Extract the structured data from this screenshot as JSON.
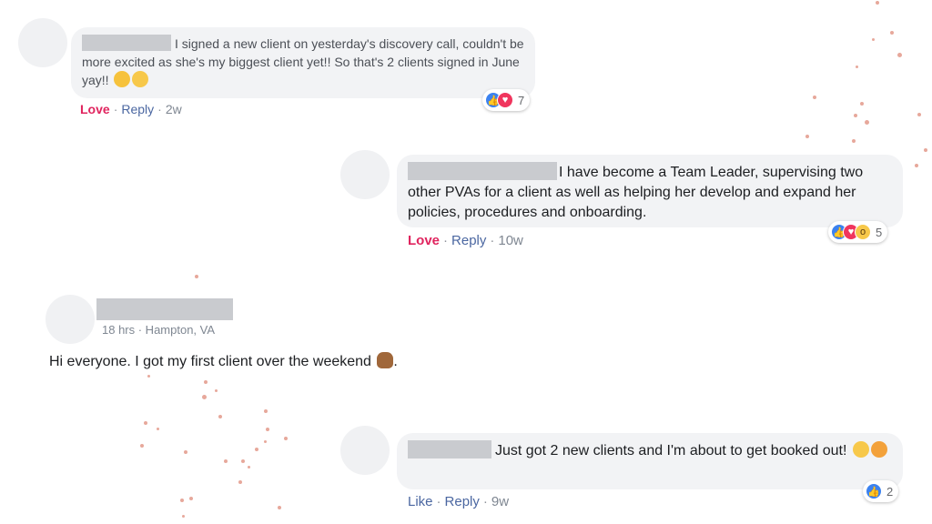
{
  "comments": [
    {
      "text": "I signed a new client on yesterday's discovery call, couldn't be more excited as she's my biggest client yet!! So that's 2 clients signed in June yay!!",
      "emoji": [
        "party-face-emoji",
        "grinning-face-emoji"
      ],
      "reactions": {
        "icons": [
          "like",
          "love"
        ],
        "count": "7"
      },
      "action_primary": "Love",
      "reply": "Reply",
      "time": "2w"
    },
    {
      "text": "I have become a Team Leader, supervising two other PVAs for a client as well as helping her develop and expand her policies, procedures and onboarding.",
      "reactions": {
        "icons": [
          "like",
          "love",
          "wow"
        ],
        "count": "5"
      },
      "action_primary": "Love",
      "reply": "Reply",
      "time": "10w"
    },
    {
      "text": "Just got 2 new clients and I'm about to get booked out!",
      "emoji": [
        "grinning-face-emoji",
        "smiling-hearts-emoji"
      ],
      "reactions": {
        "icons": [
          "like"
        ],
        "count": "2"
      },
      "action_primary": "Like",
      "reply": "Reply",
      "time": "9w"
    }
  ],
  "post": {
    "meta": "18 hrs · Hampton, VA",
    "text": "Hi everyone. I got my first client over the weekend",
    "emoji": "raised-hands-emoji",
    "end_punct": "."
  },
  "colors": {
    "love_text": "#e0245e",
    "link_text": "#4b67a1",
    "bubble_bg": "#f2f3f5",
    "dots": "#e7a89b"
  }
}
